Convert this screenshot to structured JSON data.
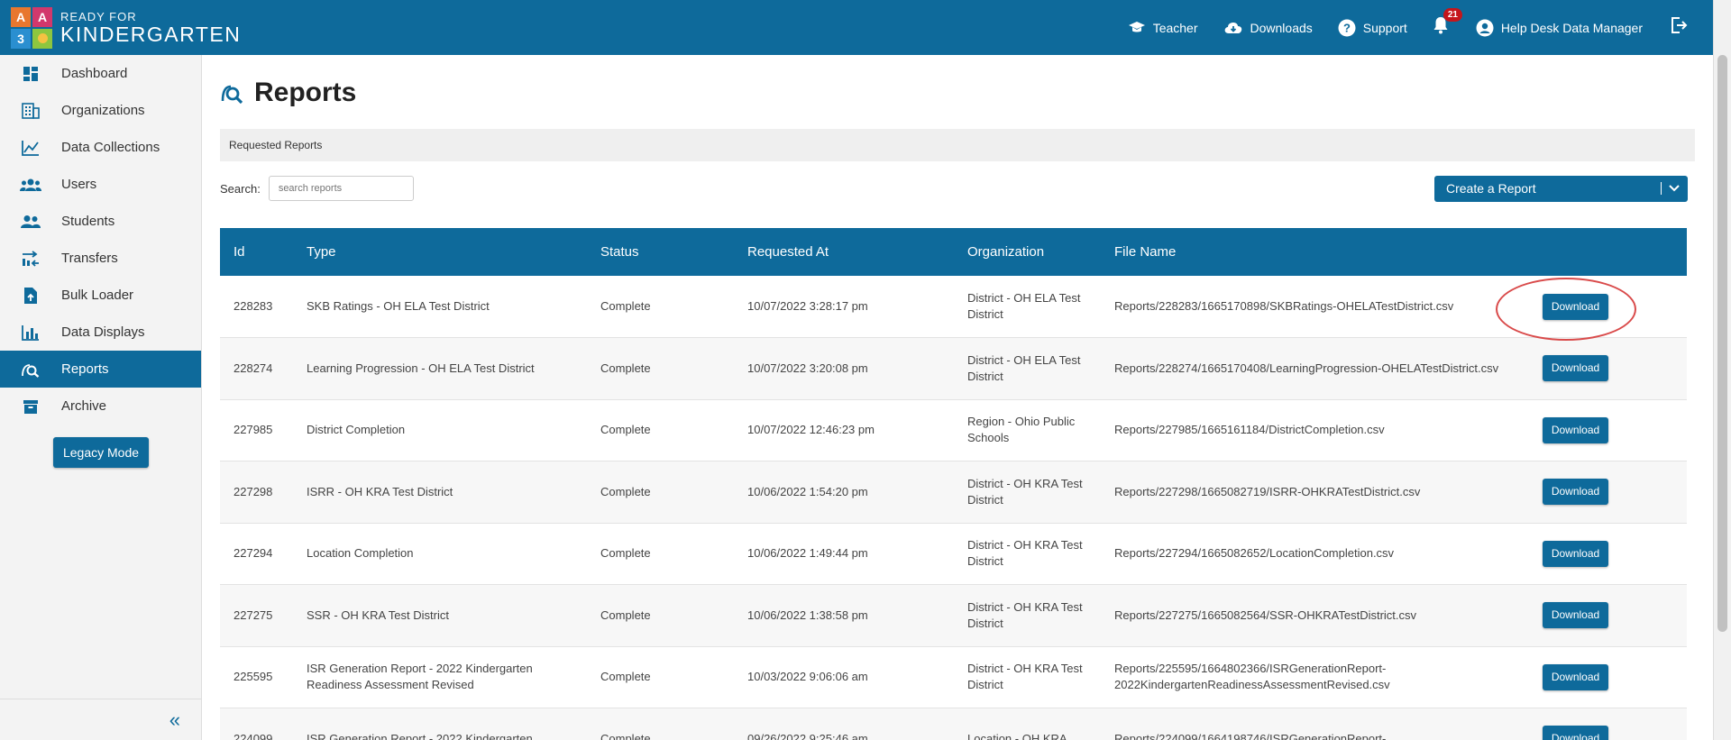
{
  "brand": {
    "small": "READY FOR",
    "big": "KINDERGARTEN"
  },
  "topnav": {
    "teacher": "Teacher",
    "downloads": "Downloads",
    "support": "Support",
    "notifications": "21",
    "user": "Help Desk Data Manager"
  },
  "sidebar": {
    "items": [
      {
        "label": "Dashboard",
        "icon": "dashboard-icon"
      },
      {
        "label": "Organizations",
        "icon": "building-icon"
      },
      {
        "label": "Data Collections",
        "icon": "line-chart-icon"
      },
      {
        "label": "Users",
        "icon": "users-icon"
      },
      {
        "label": "Students",
        "icon": "students-icon"
      },
      {
        "label": "Transfers",
        "icon": "transfer-icon"
      },
      {
        "label": "Bulk Loader",
        "icon": "file-upload-icon"
      },
      {
        "label": "Data Displays",
        "icon": "bar-chart-icon"
      },
      {
        "label": "Reports",
        "icon": "report-search-icon",
        "active": true
      },
      {
        "label": "Archive",
        "icon": "archive-icon"
      }
    ],
    "legacy": "Legacy Mode",
    "collapse": "«"
  },
  "page": {
    "title": "Reports",
    "subheading": "Requested Reports",
    "search_label": "Search:",
    "search_placeholder": "search reports",
    "search_value": "",
    "create_label": "Create a Report"
  },
  "table": {
    "headers": [
      "Id",
      "Type",
      "Status",
      "Requested At",
      "Organization",
      "File Name",
      ""
    ],
    "download_label": "Download",
    "rows": [
      {
        "id": "228283",
        "type": "SKB Ratings - OH ELA Test District",
        "status": "Complete",
        "requested": "10/07/2022 3:28:17 pm",
        "org": "District - OH ELA Test District",
        "file": "Reports/228283/1665170898/SKBRatings-OHELATestDistrict.csv"
      },
      {
        "id": "228274",
        "type": "Learning Progression - OH ELA Test District",
        "status": "Complete",
        "requested": "10/07/2022 3:20:08 pm",
        "org": "District - OH ELA Test District",
        "file": "Reports/228274/1665170408/LearningProgression-OHELATestDistrict.csv"
      },
      {
        "id": "227985",
        "type": "District Completion",
        "status": "Complete",
        "requested": "10/07/2022 12:46:23 pm",
        "org": "Region - Ohio Public Schools",
        "file": "Reports/227985/1665161184/DistrictCompletion.csv"
      },
      {
        "id": "227298",
        "type": "ISRR - OH KRA Test District",
        "status": "Complete",
        "requested": "10/06/2022 1:54:20 pm",
        "org": "District - OH KRA Test District",
        "file": "Reports/227298/1665082719/ISRR-OHKRATestDistrict.csv"
      },
      {
        "id": "227294",
        "type": "Location Completion",
        "status": "Complete",
        "requested": "10/06/2022 1:49:44 pm",
        "org": "District - OH KRA Test District",
        "file": "Reports/227294/1665082652/LocationCompletion.csv"
      },
      {
        "id": "227275",
        "type": "SSR - OH KRA Test District",
        "status": "Complete",
        "requested": "10/06/2022 1:38:58 pm",
        "org": "District - OH KRA Test District",
        "file": "Reports/227275/1665082564/SSR-OHKRATestDistrict.csv"
      },
      {
        "id": "225595",
        "type": "ISR Generation Report - 2022 Kindergarten Readiness Assessment Revised",
        "status": "Complete",
        "requested": "10/03/2022 9:06:06 am",
        "org": "District - OH KRA Test District",
        "file": "Reports/225595/1664802366/ISRGenerationReport-2022KindergartenReadinessAssessmentRevised.csv"
      },
      {
        "id": "224099",
        "type": "ISR Generation Report - 2022 Kindergarten",
        "status": "Complete",
        "requested": "09/26/2022 9:25:46 am",
        "org": "Location - OH KRA",
        "file": "Reports/224099/1664198746/ISRGenerationReport-"
      }
    ]
  }
}
